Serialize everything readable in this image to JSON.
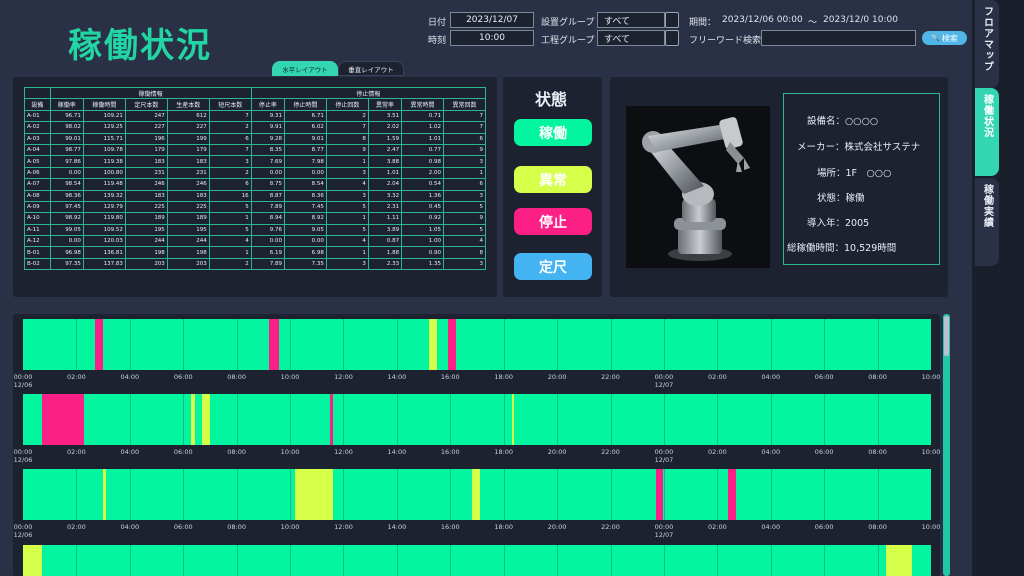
{
  "page_title": "稼働状況",
  "filters": {
    "date_label": "日付",
    "date_value": "2023/12/07",
    "time_label": "時刻",
    "time_value": "10:00",
    "equip_group_label": "設置グループ",
    "equip_group_value": "すべて",
    "process_group_label": "工程グループ",
    "process_group_value": "すべて",
    "period_label": "期間：",
    "period_start": "2023/12/06  00:00",
    "period_sep": "～",
    "period_end": "2023/12/0  10:00",
    "keyword_label": "フリーワード検索",
    "keyword_value": "",
    "search_label": "検索"
  },
  "layout_tabs": {
    "horizontal": "水平レイアウト",
    "vertical": "垂直レイアウト"
  },
  "table": {
    "group_headers": {
      "op": "稼働情報",
      "stop": "停止情報"
    },
    "columns": [
      "設備",
      "稼働率",
      "稼働時間",
      "定尺本数",
      "生産本数",
      "短尺本数",
      "停止率",
      "停止時間",
      "停止回数",
      "異常率",
      "異常時間",
      "異常回数"
    ],
    "rows": [
      [
        "A-01",
        "96.71",
        "109.21",
        "247",
        "612",
        "7",
        "9.31",
        "6.71",
        "2",
        "3.51",
        "0.71",
        "7"
      ],
      [
        "A-02",
        "98.02",
        "129.25",
        "227",
        "227",
        "2",
        "9.91",
        "6.02",
        "7",
        "2.02",
        "1.02",
        "7"
      ],
      [
        "A-03",
        "99.01",
        "115.71",
        "196",
        "199",
        "6",
        "9.28",
        "9.01",
        "8",
        "1.59",
        "1.01",
        "6"
      ],
      [
        "A-04",
        "98.77",
        "109.78",
        "179",
        "179",
        "7",
        "8.35",
        "8.77",
        "9",
        "2.47",
        "0.77",
        "9"
      ],
      [
        "A-05",
        "97.86",
        "119.38",
        "183",
        "183",
        "3",
        "7.69",
        "7.98",
        "1",
        "3.88",
        "0.98",
        "3"
      ],
      [
        "A-06",
        "0.00",
        "100.80",
        "231",
        "231",
        "2",
        "0.00",
        "0.00",
        "3",
        "1.01",
        "2.00",
        "1"
      ],
      [
        "A-07",
        "98.54",
        "119.48",
        "246",
        "246",
        "6",
        "8.75",
        "8.54",
        "4",
        "2.04",
        "0.54",
        "6"
      ],
      [
        "A-08",
        "98.36",
        "139.32",
        "183",
        "183",
        "16",
        "8.87",
        "8.36",
        "3",
        "3.32",
        "1.36",
        "3"
      ],
      [
        "A-09",
        "97.45",
        "129.79",
        "225",
        "225",
        "5",
        "7.89",
        "7.45",
        "5",
        "2.31",
        "0.45",
        "5"
      ],
      [
        "A-10",
        "98.92",
        "119.80",
        "189",
        "189",
        "1",
        "8.94",
        "8.92",
        "1",
        "1.11",
        "0.92",
        "9"
      ],
      [
        "A-11",
        "99.05",
        "109.52",
        "195",
        "195",
        "5",
        "9.76",
        "9.05",
        "5",
        "3.89",
        "1.05",
        "5"
      ],
      [
        "A-12",
        "0.00",
        "120.03",
        "244",
        "244",
        "4",
        "0.00",
        "0.00",
        "4",
        "0.87",
        "1.00",
        "4"
      ],
      [
        "B-01",
        "96.98",
        "136.81",
        "198",
        "198",
        "1",
        "6.19",
        "6.98",
        "1",
        "1.88",
        "0.90",
        "8"
      ],
      [
        "B-02",
        "97.35",
        "137.83",
        "203",
        "203",
        "2",
        "7.89",
        "7.35",
        "3",
        "2.33",
        "1.35",
        "3"
      ]
    ]
  },
  "status": {
    "title": "状態",
    "buttons": [
      {
        "label": "稼働",
        "color": "#04f59f"
      },
      {
        "label": "異常",
        "color": "#d6ff4a"
      },
      {
        "label": "停止",
        "color": "#fb1f86"
      },
      {
        "label": "定尺",
        "color": "#43b4f1"
      }
    ]
  },
  "equipment": {
    "name": "設備名：○○○○",
    "maker": "メーカー：株式会社サステナ",
    "place": "場所：1F　○○○",
    "state": "状態：稼働",
    "year": "導入年：2005",
    "total_hours": "総稼働時間：10,529時間"
  },
  "timeline": {
    "ticks": [
      "00:00",
      "02:00",
      "04:00",
      "06:00",
      "08:00",
      "10:00",
      "12:00",
      "14:00",
      "16:00",
      "18:00",
      "20:00",
      "22:00",
      "00:00",
      "02:00",
      "04:00",
      "06:00",
      "08:00",
      "10:00"
    ],
    "date_start": "12/06",
    "date_mid": "12/07",
    "colors": {
      "run": "#04f59f",
      "error": "#d6ff4a",
      "stop": "#fb1f86"
    },
    "rows": [
      {
        "segments": [
          {
            "s": 2.7,
            "e": 3.0,
            "t": "stop"
          },
          {
            "s": 9.2,
            "e": 9.6,
            "t": "stop"
          },
          {
            "s": 15.2,
            "e": 15.5,
            "t": "error"
          },
          {
            "s": 15.9,
            "e": 16.2,
            "t": "stop"
          }
        ]
      },
      {
        "segments": [
          {
            "s": 0.7,
            "e": 1.1,
            "t": "stop"
          },
          {
            "s": 1.1,
            "e": 2.3,
            "t": "stop"
          },
          {
            "s": 6.3,
            "e": 6.45,
            "t": "error"
          },
          {
            "s": 6.7,
            "e": 7.0,
            "t": "error"
          },
          {
            "s": 11.5,
            "e": 11.6,
            "t": "stop"
          },
          {
            "s": 18.3,
            "e": 18.4,
            "t": "error"
          }
        ]
      },
      {
        "segments": [
          {
            "s": 3.0,
            "e": 3.1,
            "t": "error"
          },
          {
            "s": 10.2,
            "e": 11.6,
            "t": "error"
          },
          {
            "s": 16.8,
            "e": 17.1,
            "t": "error"
          },
          {
            "s": 23.7,
            "e": 23.95,
            "t": "stop"
          },
          {
            "s": 26.4,
            "e": 26.7,
            "t": "stop"
          }
        ]
      },
      {
        "segments": [
          {
            "s": 0.0,
            "e": 0.7,
            "t": "error"
          },
          {
            "s": 32.3,
            "e": 33.3,
            "t": "error"
          }
        ]
      }
    ]
  },
  "sidebar": {
    "tabs": [
      {
        "label": "フロアマップ",
        "active": false
      },
      {
        "label": "稼働状況",
        "active": true
      },
      {
        "label": "稼働実績",
        "active": false
      }
    ]
  }
}
